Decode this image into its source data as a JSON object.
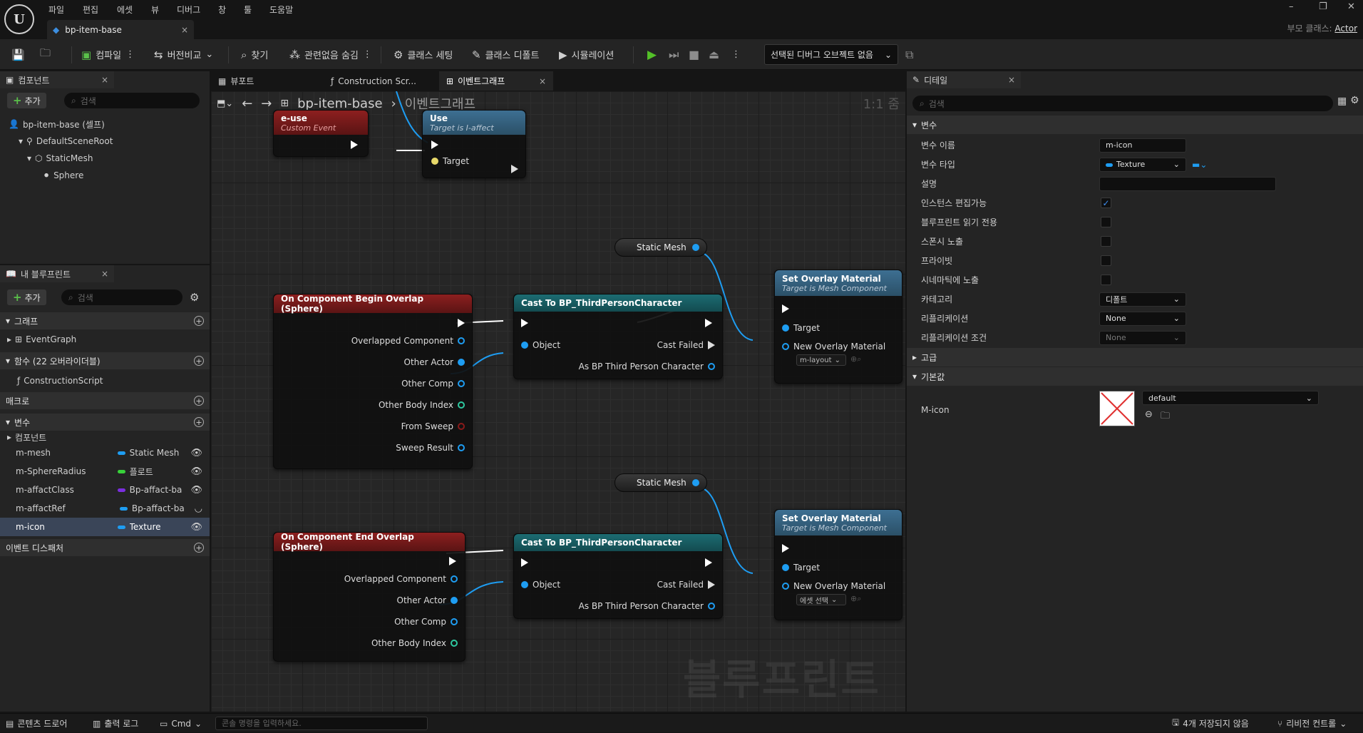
{
  "menu": [
    "파일",
    "편집",
    "에셋",
    "뷰",
    "디버그",
    "창",
    "툴",
    "도움말"
  ],
  "doc_tab": {
    "title": "bp-item-base",
    "close": "×"
  },
  "window": {
    "minimize": "–",
    "restore": "❐",
    "close": "✕"
  },
  "parent_class": {
    "label": "부모 클래스:",
    "value": "Actor"
  },
  "toolbar": {
    "compile": "컴파일",
    "diff": "버전비교",
    "find": "찾기",
    "hide_unrelated": "관련없음 숨김",
    "class_settings": "클래스 세팅",
    "class_defaults": "클래스 디폴트",
    "simulation": "시뮬레이션",
    "debug_object": "선택된 디버그 오브젝트 없음"
  },
  "components_panel": {
    "tab": "컴포넌트",
    "add": "추가",
    "search_placeholder": "검색",
    "tree": [
      "bp-item-base (셀프)",
      "DefaultSceneRoot",
      "StaticMesh",
      "Sphere"
    ]
  },
  "myblueprint_panel": {
    "tab": "내 블루프린트",
    "add": "추가",
    "search_placeholder": "검색",
    "graph_section": "그래프",
    "graph_items": [
      "EventGraph"
    ],
    "function_section": "함수 (22 오버라이더블)",
    "function_items": [
      "ConstructionScript"
    ],
    "macro_section": "매크로",
    "variable_section": "변수",
    "component_group": "컴포넌트",
    "variables": [
      {
        "name": "m-mesh",
        "type": "Static Mesh",
        "color": "#1e9df2"
      },
      {
        "name": "m-SphereRadius",
        "type": "플로트",
        "color": "#38d13a"
      },
      {
        "name": "m-affactClass",
        "type": "Bp-affact-ba",
        "color": "#7b2ee0"
      },
      {
        "name": "m-affactRef",
        "type": "Bp-affact-ba",
        "color": "#1e9df2"
      },
      {
        "name": "m-icon",
        "type": "Texture",
        "color": "#1e9df2"
      }
    ],
    "dispatcher_section": "이벤트 디스패처"
  },
  "editor_tabs": [
    "뷰포트",
    "Construction Scr...",
    "이벤트그래프"
  ],
  "breadcrumb": {
    "root": "bp-item-base",
    "current": "이벤트그래프",
    "zoom": "1:1 줌"
  },
  "nodes": {
    "e_use": {
      "title": "e-use",
      "sub": "Custom Event"
    },
    "use": {
      "title": "Use",
      "sub": "Target is I-affect",
      "target": "Target"
    },
    "static_mesh_1": "Static Mesh",
    "static_mesh_2": "Static Mesh",
    "begin_overlap": {
      "title": "On Component Begin Overlap (Sphere)",
      "pins": [
        "Overlapped Component",
        "Other Actor",
        "Other Comp",
        "Other Body Index",
        "From Sweep",
        "Sweep Result"
      ]
    },
    "end_overlap": {
      "title": "On Component End Overlap (Sphere)",
      "pins": [
        "Overlapped Component",
        "Other Actor",
        "Other Comp",
        "Other Body Index"
      ]
    },
    "cast_1": {
      "title": "Cast To BP_ThirdPersonCharacter",
      "object": "Object",
      "failed": "Cast Failed",
      "as": "As BP Third Person Character"
    },
    "cast_2": {
      "title": "Cast To BP_ThirdPersonCharacter",
      "object": "Object",
      "failed": "Cast Failed",
      "as": "As BP Third Person Character"
    },
    "set_overlay_1": {
      "title": "Set Overlay Material",
      "sub": "Target is Mesh Component",
      "target": "Target",
      "new": "New Overlay Material",
      "value": "m-layout"
    },
    "set_overlay_2": {
      "title": "Set Overlay Material",
      "sub": "Target is Mesh Component",
      "target": "Target",
      "new": "New Overlay Material",
      "value": "에셋 선택"
    }
  },
  "watermark": "블루프린트",
  "details": {
    "tab": "디테일",
    "search_placeholder": "검색",
    "variable_section": "변수",
    "rows": {
      "var_name": {
        "label": "변수 이름",
        "value": "m-icon"
      },
      "var_type": {
        "label": "변수 타입",
        "value": "Texture"
      },
      "desc": {
        "label": "설명",
        "value": ""
      },
      "instance_editable": {
        "label": "인스턴스 편집가능"
      },
      "bp_readonly": {
        "label": "블루프린트 읽기 전용"
      },
      "spawn_expose": {
        "label": "스폰시 노출"
      },
      "private": {
        "label": "프라이빗"
      },
      "cinematic": {
        "label": "시네마틱에 노출"
      },
      "category": {
        "label": "카테고리",
        "value": "디폴트"
      },
      "replication": {
        "label": "리플리케이션",
        "value": "None"
      },
      "rep_condition": {
        "label": "리플리케이션 조건",
        "value": "None"
      }
    },
    "advanced_section": "고급",
    "default_section": "기본값",
    "default_row": {
      "label": "M-icon",
      "value": "default"
    }
  },
  "statusbar": {
    "content_drawer": "콘텐츠 드로어",
    "output_log": "출력 로그",
    "cmd": "Cmd",
    "cmd_placeholder": "콘솔 명령을 입력하세요.",
    "unsaved": "4개 저장되지 않음",
    "revision": "리비전 컨트롤"
  }
}
